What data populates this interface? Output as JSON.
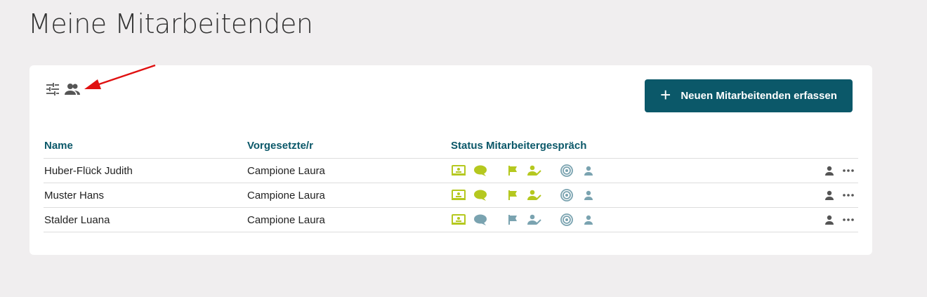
{
  "page": {
    "title": "Meine Mitarbeitenden"
  },
  "toolbar": {
    "filter_icon": "tune-sliders-icon",
    "people_icon": "people-group-icon",
    "add_button_label": "Neuen Mitarbeitenden erfassen",
    "add_button_icon": "plus-icon"
  },
  "table": {
    "headers": {
      "name": "Name",
      "supervisor": "Vorgesetzte/r",
      "status": "Status Mitarbeitergespräch"
    },
    "rows": [
      {
        "name": "Huber-Flück Judith",
        "supervisor": "Campione Laura",
        "status": [
          "green",
          "green",
          "green",
          "green",
          "teal",
          "teal"
        ]
      },
      {
        "name": "Muster Hans",
        "supervisor": "Campione Laura",
        "status": [
          "green",
          "green",
          "green",
          "green",
          "teal",
          "teal"
        ]
      },
      {
        "name": "Stalder Luana",
        "supervisor": "Campione Laura",
        "status": [
          "green",
          "teal",
          "teal",
          "teal",
          "teal",
          "teal"
        ]
      }
    ]
  },
  "colors": {
    "accent": "#0b5869",
    "status_green": "#b5c81f",
    "status_teal": "#7aa3b0",
    "annotation_arrow": "#e01010"
  }
}
